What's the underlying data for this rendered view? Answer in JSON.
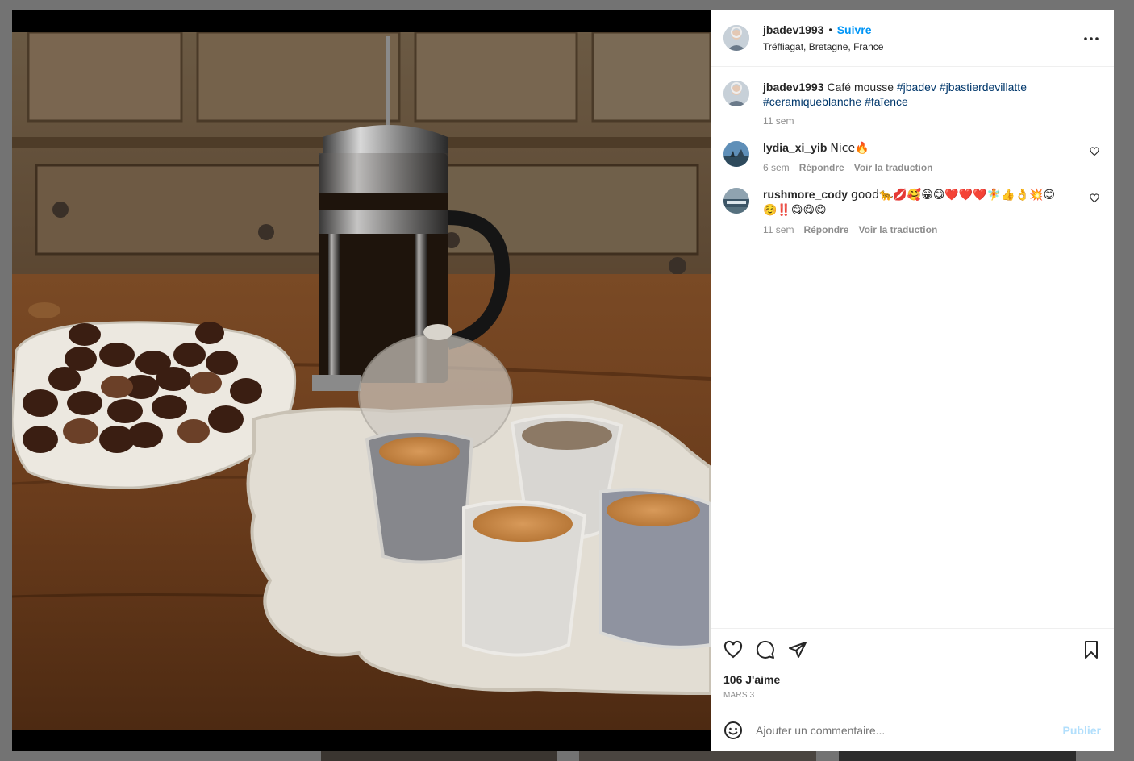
{
  "post": {
    "author": "jbadev1993",
    "separator": "•",
    "follow_label": "Suivre",
    "location": "Tréffiagat, Bretagne, France"
  },
  "caption": {
    "username": "jbadev1993",
    "text": "Café mousse",
    "hashtags": [
      "#jbadev",
      "#jbastierdevillatte",
      "#ceramiqueblanche",
      "#faïence"
    ],
    "time": "11 sem"
  },
  "comments": [
    {
      "username": "lydia_xi_yib",
      "text": "Nice🔥",
      "time": "6 sem",
      "reply_label": "Répondre",
      "translate_label": "Voir la traduction"
    },
    {
      "username": "rushmore_cody",
      "text": "good🐆💋🥰😁😋❤️❤️❤️🧚👍👌💥😊☺️‼️😋😋😋",
      "time": "11 sem",
      "reply_label": "Répondre",
      "translate_label": "Voir la traduction"
    }
  ],
  "footer": {
    "likes": "106 J'aime",
    "date": "MARS 3"
  },
  "composer": {
    "placeholder": "Ajouter un commentaire...",
    "publish_label": "Publier"
  },
  "icons": {
    "more": "more-horizontal-icon",
    "like": "heart-icon",
    "comment": "comment-bubble-icon",
    "share": "paper-plane-icon",
    "save": "bookmark-icon",
    "emoji": "emoji-smiley-icon"
  },
  "colors": {
    "follow": "#0095f6",
    "hashtag": "#00376b",
    "publish_disabled": "#b2dffc",
    "muted": "#8e8e8e"
  }
}
